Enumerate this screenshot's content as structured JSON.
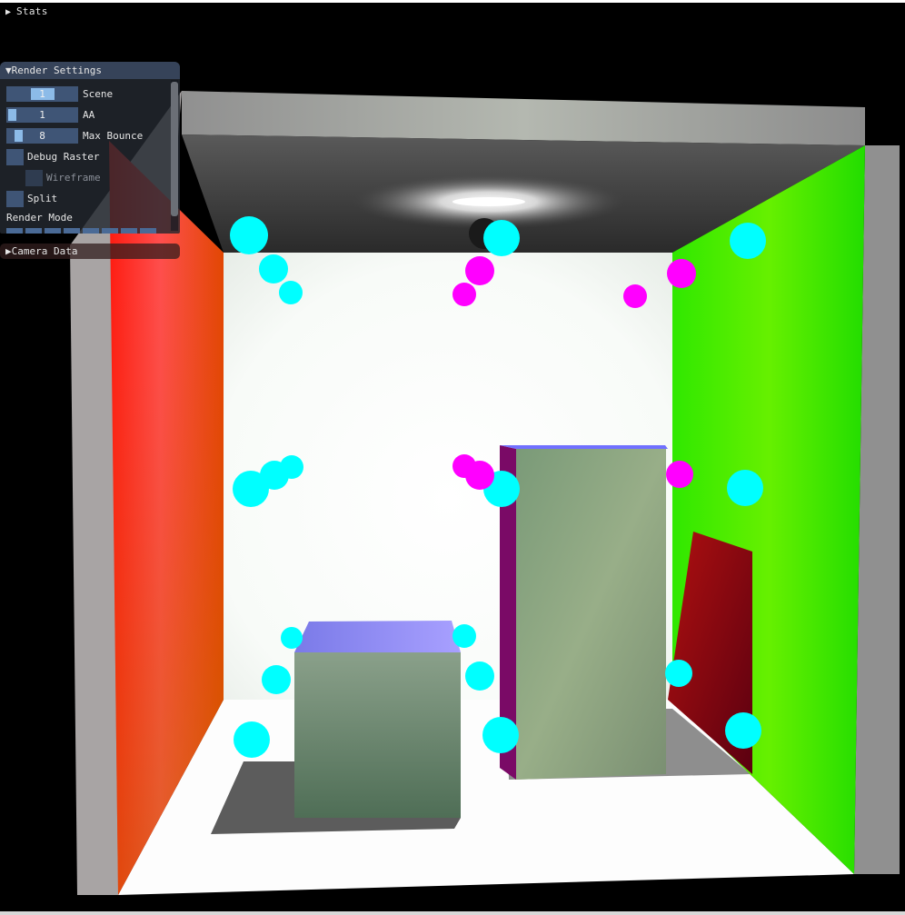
{
  "window": {
    "stats_header": "Stats",
    "render_settings": {
      "title": "Render Settings",
      "scene": {
        "label": "Scene",
        "value": "1"
      },
      "aa": {
        "label": "AA",
        "value": "1"
      },
      "max_bounce": {
        "label": "Max Bounce",
        "value": "8"
      },
      "debug_raster": {
        "label": "Debug Raster",
        "checked": false
      },
      "wireframe": {
        "label": "Wireframe",
        "checked": false,
        "enabled": false
      },
      "split": {
        "label": "Split",
        "checked": false
      },
      "render_mode_label": "Render Mode"
    },
    "camera_data_header": "Camera Data"
  },
  "colors": {
    "panel_bg": "#232830",
    "widget": "#3f5576",
    "slider_grab": "#8cbbe8",
    "wall_left": "#ff2020",
    "wall_right": "#33ee00",
    "marker_cyan": "#00ffff",
    "marker_magenta": "#ff00ff"
  },
  "icons": {
    "collapsed": "triangle-right-icon",
    "expanded": "triangle-down-icon"
  }
}
